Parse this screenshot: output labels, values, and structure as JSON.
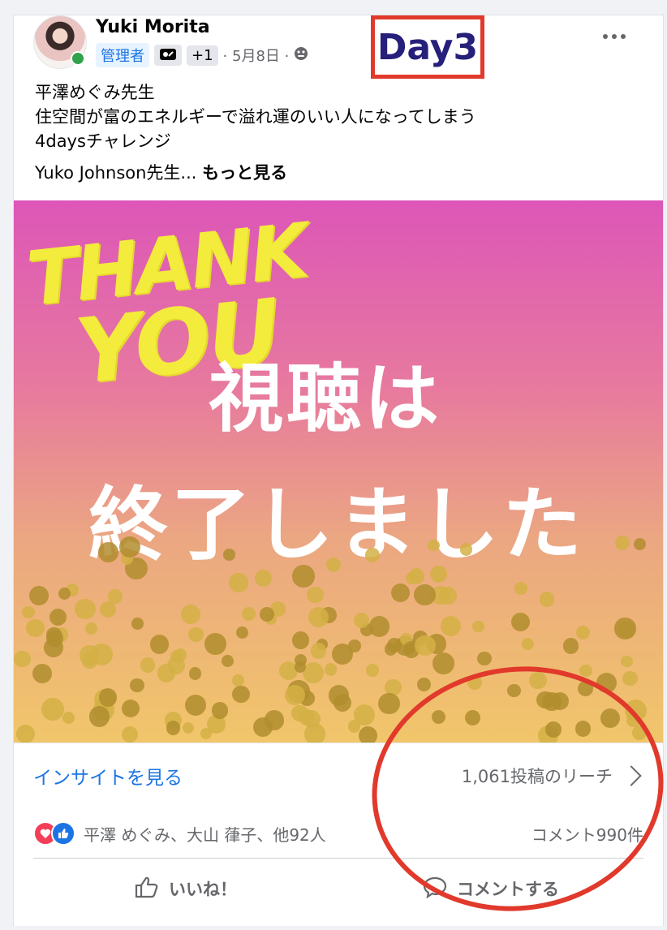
{
  "post": {
    "author": "Yuki Morita",
    "admin_badge": "管理者",
    "plus_badge": "+1",
    "date": "· 5月8日 ·",
    "text_lines": [
      "平澤めぐみ先生",
      "住空間が富のエネルギーで溢れ運のいい人になってしまう",
      "4daysチャレンジ"
    ],
    "truncated_text": "Yuko Johnson先生... ",
    "see_more": "もっと見る"
  },
  "annotation": {
    "day_label": "Day3",
    "color": "#e1392b"
  },
  "image": {
    "thank_line1": "THANK",
    "thank_line2": "YOU",
    "headline1": "視聴は",
    "headline2": "終了しました"
  },
  "stats": {
    "insight_link": "インサイトを見る",
    "reach": "1,061投稿のリーチ",
    "reactors": "平澤 めぐみ、大山 葎子、他92人",
    "comments": "コメント990件"
  },
  "actions": {
    "like": "いいね！",
    "comment": "コメントする"
  },
  "colors": {
    "accent": "#1b74e4",
    "online": "#31a24c",
    "love": "#f33e58"
  },
  "icons": [
    "avatar",
    "online-indicator",
    "badge-icon",
    "globe-icon",
    "more-icon",
    "chevron-right-icon",
    "love-reaction-icon",
    "like-reaction-icon",
    "thumbs-up-icon",
    "comment-icon"
  ]
}
